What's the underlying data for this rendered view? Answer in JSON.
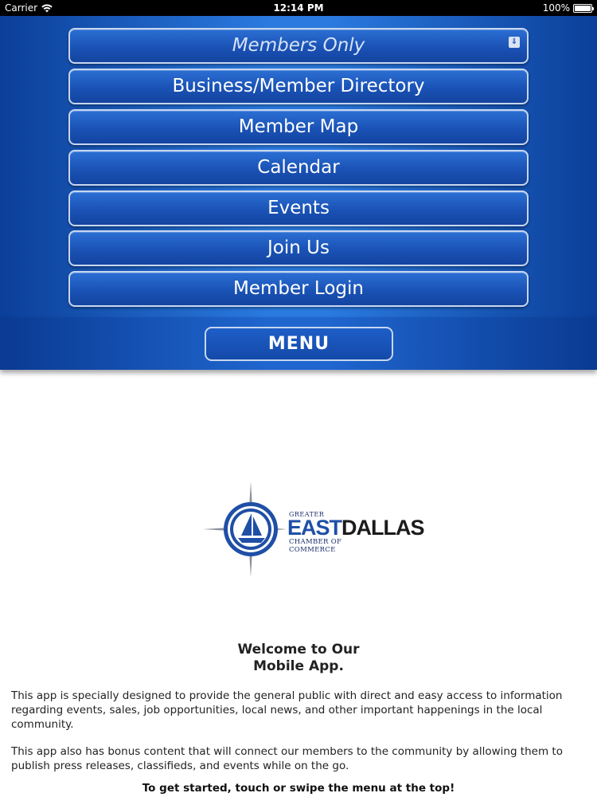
{
  "status_bar": {
    "carrier": "Carrier",
    "time": "12:14 PM",
    "battery": "100%"
  },
  "menu": {
    "items": [
      {
        "label": "Members Only",
        "icon": "chevron-double-down-icon"
      },
      {
        "label": "Business/Member Directory"
      },
      {
        "label": "Member Map"
      },
      {
        "label": "Calendar"
      },
      {
        "label": "Events"
      },
      {
        "label": "Join Us"
      },
      {
        "label": "Member Login"
      }
    ],
    "toggle_label": "MENU"
  },
  "logo": {
    "greater": "GREATER",
    "east": "EAST",
    "dallas": "DALLAS",
    "chamber": "CHAMBER OF COMMERCE"
  },
  "welcome": {
    "title_line1": "Welcome to Our",
    "title_line2": "Mobile App.",
    "paragraph1": "This app is specially designed to provide the general public with direct and easy access to information regarding events, sales, job opportunities, local news, and other important happenings in the local community.",
    "paragraph2": "This app also has bonus content that will connect our members to the community by allowing them to publish press releases, classifieds, and events while on the go.",
    "cta": "To get started, touch or swipe the menu at the top!"
  },
  "colors": {
    "menu_blue": "#1a52b5",
    "menu_border": "#c7d6f0",
    "logo_blue": "#1f4fa6"
  }
}
